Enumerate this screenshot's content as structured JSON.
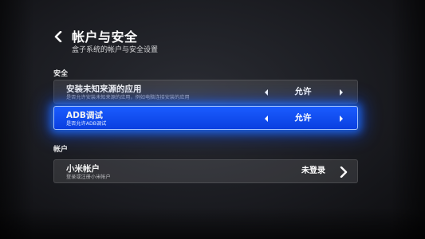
{
  "header": {
    "title": "帐户与安全",
    "subtitle": "盒子系统的帐户与安全设置"
  },
  "sections": {
    "security": {
      "label": "安全",
      "items": [
        {
          "title": "安装未知来源的应用",
          "description": "是否允许安装未知来源的应用，例如电脑连接安装的应用",
          "value": "允许"
        },
        {
          "title": "ADB调试",
          "description": "是否允许ADB调试",
          "value": "允许"
        }
      ]
    },
    "account": {
      "label": "帐户",
      "items": [
        {
          "title": "小米帐户",
          "description": "登录或注册小米帐户",
          "value": "未登录"
        }
      ]
    }
  },
  "colors": {
    "selected_row": "#0a3fe0",
    "selected_glow": "#1e6eff"
  },
  "icons": {
    "back": "chevron-left-icon",
    "prev": "triangle-left-icon",
    "next": "triangle-right-icon",
    "enter": "chevron-right-icon"
  }
}
